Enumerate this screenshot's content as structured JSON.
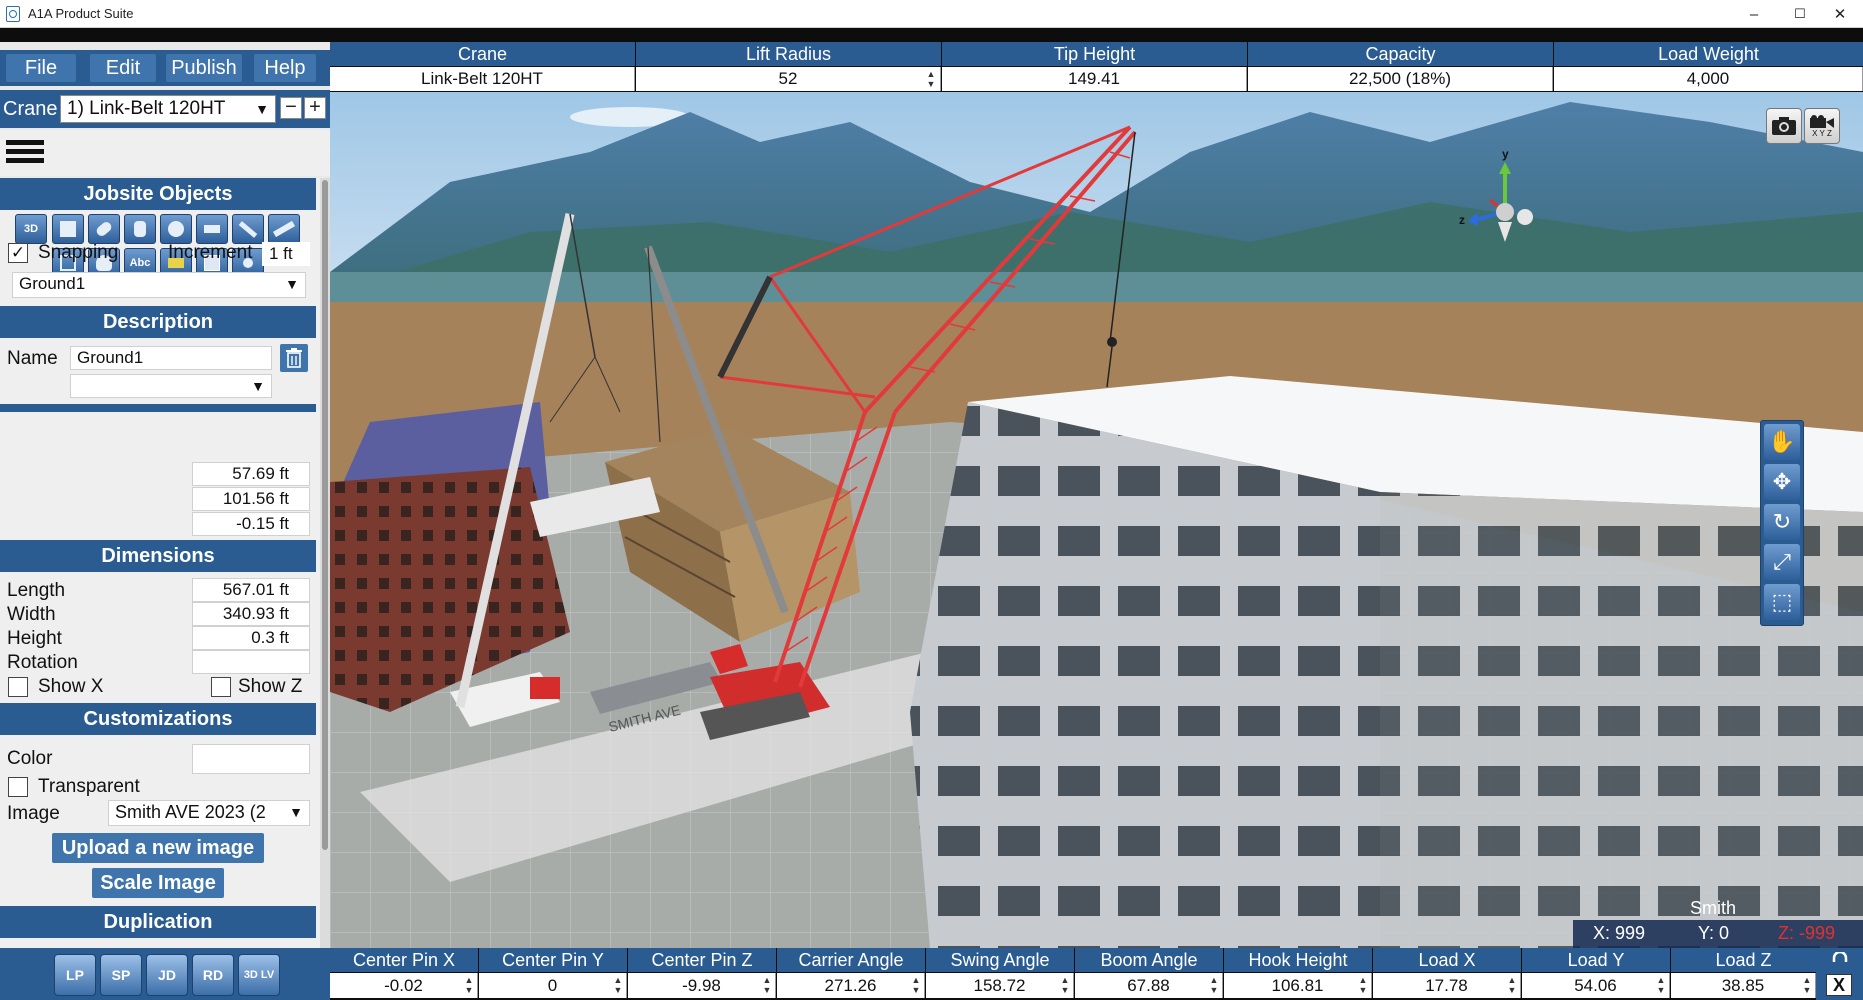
{
  "window": {
    "title": "A1A Product Suite",
    "minimize": "–",
    "maximize": "☐",
    "close": "✕"
  },
  "menu": {
    "file": "File",
    "edit": "Edit",
    "publish": "Publish",
    "help": "Help"
  },
  "crane_selector": {
    "label": "Crane",
    "value": "1) Link-Belt 120HT",
    "minus": "−",
    "plus": "+"
  },
  "jobsite_objects": {
    "title": "Jobsite Objects",
    "tools_row1": [
      "3D",
      "",
      "",
      "",
      "",
      "",
      "",
      ""
    ],
    "tools_row2": [
      "",
      "",
      "Abc",
      "",
      "",
      ""
    ],
    "snapping_label": "Snapping",
    "snapping_checked": "✓",
    "increment_label": "Increment",
    "increment_value": "1 ft",
    "object_select": "Ground1"
  },
  "description": {
    "title": "Description",
    "name_label": "Name",
    "name_value": "Ground1",
    "sub_select": "",
    "pos_x": "57.69 ft",
    "pos_y": "101.56 ft",
    "pos_z": "-0.15 ft"
  },
  "dimensions": {
    "title": "Dimensions",
    "length_label": "Length",
    "length_value": "567.01 ft",
    "width_label": "Width",
    "width_value": "340.93 ft",
    "height_label": "Height",
    "height_value": "0.3 ft",
    "rotation_label": "Rotation",
    "rotation_value": "",
    "show_x_label": "Show X",
    "show_z_label": "Show Z"
  },
  "customizations": {
    "title": "Customizations",
    "color_label": "Color",
    "transparent_label": "Transparent",
    "image_label": "Image",
    "image_value": "Smith AVE 2023 (2",
    "upload_button": "Upload a new image",
    "scale_button": "Scale Image"
  },
  "duplication": {
    "title": "Duplication"
  },
  "bottom_tools": [
    "LP",
    "SP",
    "JD",
    "RD",
    "3D LV"
  ],
  "top_bar": {
    "headers": [
      "Crane",
      "Lift Radius",
      "Tip Height",
      "Capacity",
      "Load Weight"
    ],
    "values": [
      "Link-Belt 120HT",
      "52",
      "149.41",
      "22,500 (18%)",
      "4,000"
    ]
  },
  "bottom_bar": {
    "headers": [
      "Center Pin X",
      "Center Pin Y",
      "Center Pin Z",
      "Carrier Angle",
      "Swing Angle",
      "Boom Angle",
      "Hook Height",
      "Load X",
      "Load Y",
      "Load Z"
    ],
    "values": [
      "-0.02",
      "0",
      "-9.98",
      "271.26",
      "158.72",
      "67.88",
      "106.81",
      "17.78",
      "54.06",
      "38.85"
    ]
  },
  "viewport": {
    "gizmo_y": "y",
    "gizmo_z": "z",
    "street_label": "SMITH AVE",
    "smith_label": "Smith",
    "coord_x": "X: 999",
    "coord_y": "Y: 0",
    "coord_z": "Z: -999",
    "xyz_label": "X Y Z"
  },
  "lock_button": "X",
  "colors": {
    "accent": "#2a5c91",
    "button": "#3f74ad",
    "crane_red": "#e23a3a",
    "z_coord": "#e23030"
  }
}
